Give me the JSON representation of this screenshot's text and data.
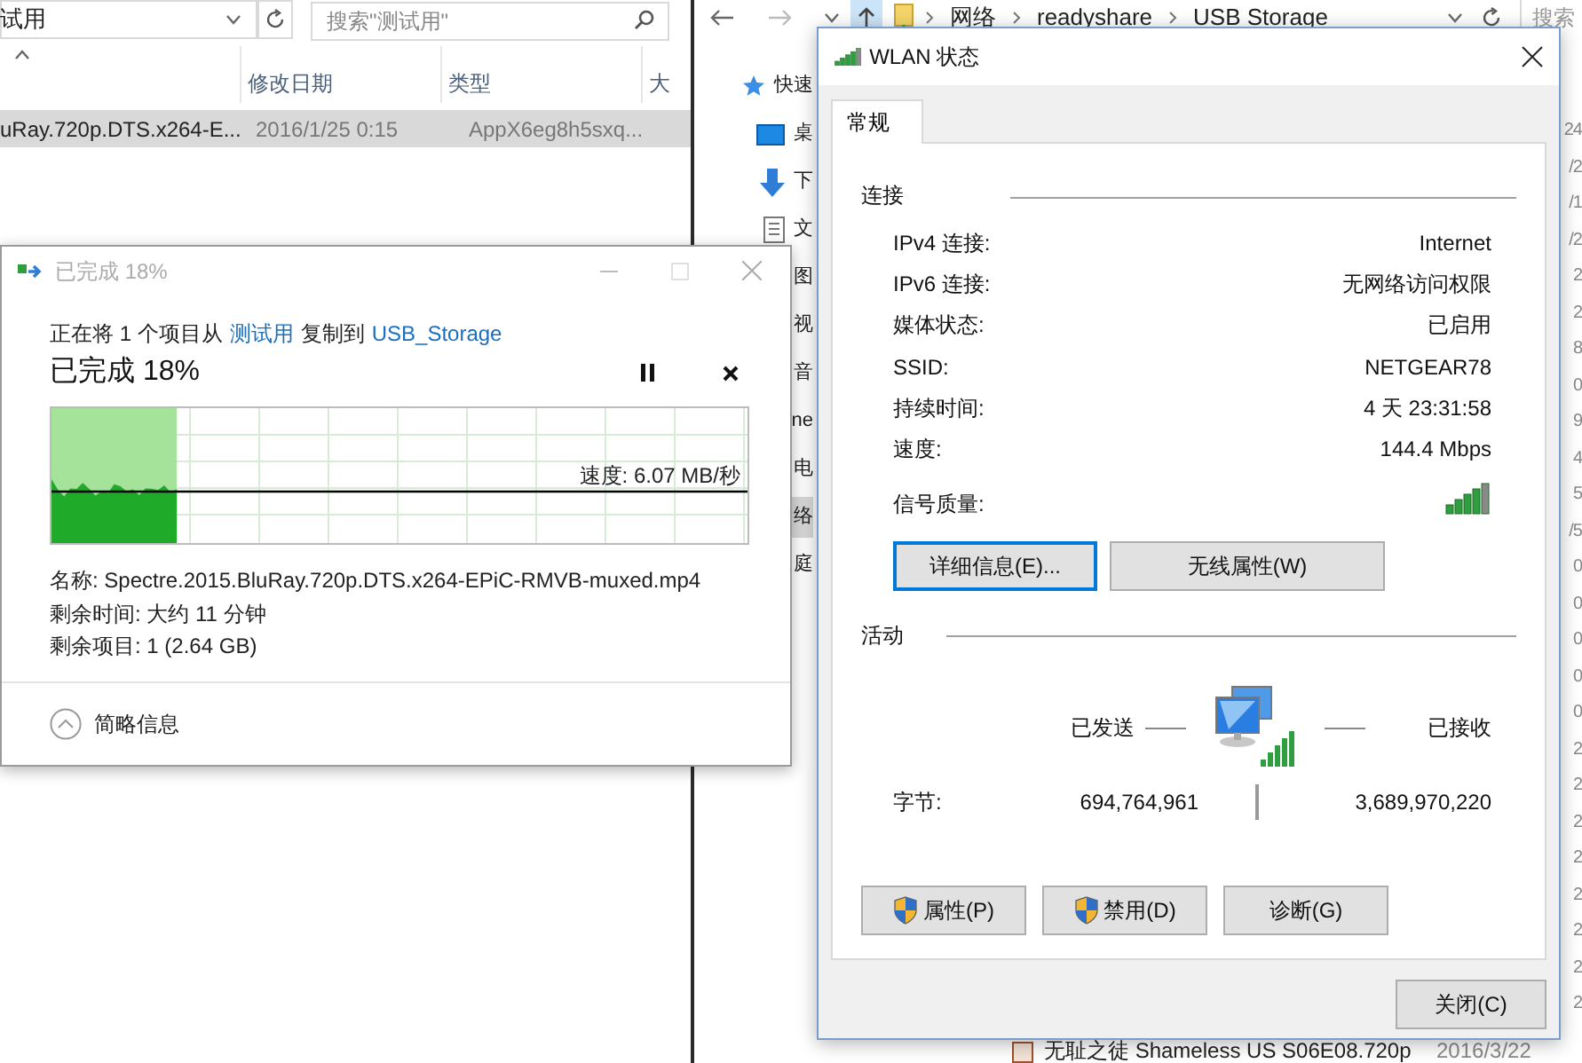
{
  "left_explorer": {
    "address": "试用",
    "search_placeholder": "搜索\"测试用\"",
    "columns": [
      "修改日期",
      "类型",
      "大"
    ],
    "rows": [
      {
        "name": "uRay.720p.DTS.x264-E...",
        "date": "2016/1/25 0:15",
        "type": "AppX6eg8h5sxq...",
        "selected": true
      }
    ]
  },
  "right_explorer": {
    "breadcrumb": [
      "网络",
      "readyshare",
      "USB Storage"
    ],
    "search_placeholder": "搜索",
    "nav_items": [
      {
        "label": "快速",
        "kind": "star",
        "selected": false
      },
      {
        "label": "桌",
        "kind": "desktop",
        "selected": false
      },
      {
        "label": "下",
        "kind": "download",
        "selected": false
      },
      {
        "label": "文",
        "kind": "document",
        "selected": false
      },
      {
        "label": "图",
        "kind": "plain",
        "selected": false
      },
      {
        "label": "视",
        "kind": "plain",
        "selected": false
      },
      {
        "label": "音",
        "kind": "plain",
        "selected": false
      },
      {
        "label": "ne",
        "kind": "plain",
        "selected": false
      },
      {
        "label": "电",
        "kind": "plain",
        "selected": false
      },
      {
        "label": "络",
        "kind": "plain",
        "selected": true
      },
      {
        "label": "庭",
        "kind": "plain",
        "selected": false
      }
    ],
    "date_fragments": [
      "24",
      "/2",
      "/1",
      "/2",
      "2",
      "2",
      "8",
      "0",
      "9",
      "4",
      "5",
      "/5",
      "0",
      "0",
      "0",
      "0",
      "0",
      "2",
      "2",
      "2",
      "2",
      "2",
      "2",
      "2",
      "2"
    ],
    "bottom_row": {
      "name": "无耻之徒 Shameless US S06E08.720p",
      "date": "2016/3/22"
    }
  },
  "copy_dialog": {
    "title": "已完成 18%",
    "message": {
      "prefix": "正在将 1 个项目从",
      "source": "测试用",
      "middle": "复制到",
      "destination": "USB_Storage"
    },
    "heading": "已完成 18%",
    "progress": {
      "level": 0.18,
      "speed": "速度: 6.07 MB/秒"
    },
    "details": [
      "名称: Spectre.2015.BluRay.720p.DTS.x264-EPiC-RMVB-muxed.mp4",
      "剩余时间: 大约 11 分钟",
      "剩余项目: 1 (2.64 GB)"
    ],
    "toggle": "简略信息"
  },
  "wlan_dialog": {
    "title": "WLAN 状态",
    "tabs": [
      {
        "label": "常规",
        "selected": true
      }
    ],
    "connection": {
      "heading": "连接",
      "rows": [
        {
          "label": "IPv4 连接:",
          "value": "Internet"
        },
        {
          "label": "IPv6 连接:",
          "value": "无网络访问权限"
        },
        {
          "label": "媒体状态:",
          "value": "已启用"
        },
        {
          "label": "SSID:",
          "value": "NETGEAR78"
        },
        {
          "label": "持续时间:",
          "value": "4 天 23:31:58"
        },
        {
          "label": "速度:",
          "value": "144.4 Mbps"
        }
      ],
      "signal_label": "信号质量:",
      "buttons": [
        {
          "label": "详细信息(E)...",
          "focused": true
        },
        {
          "label": "无线属性(W)",
          "focused": false
        }
      ]
    },
    "activity": {
      "heading": "活动",
      "sent_label": "已发送",
      "received_label": "已接收",
      "bytes_label": "字节:",
      "sent": "694,764,961",
      "received": "3,689,970,220"
    },
    "buttons": [
      {
        "label": "属性(P)",
        "shield": true
      },
      {
        "label": "禁用(D)",
        "shield": true
      },
      {
        "label": "诊断(G)",
        "shield": false
      }
    ],
    "close_button": "关闭(C)"
  }
}
